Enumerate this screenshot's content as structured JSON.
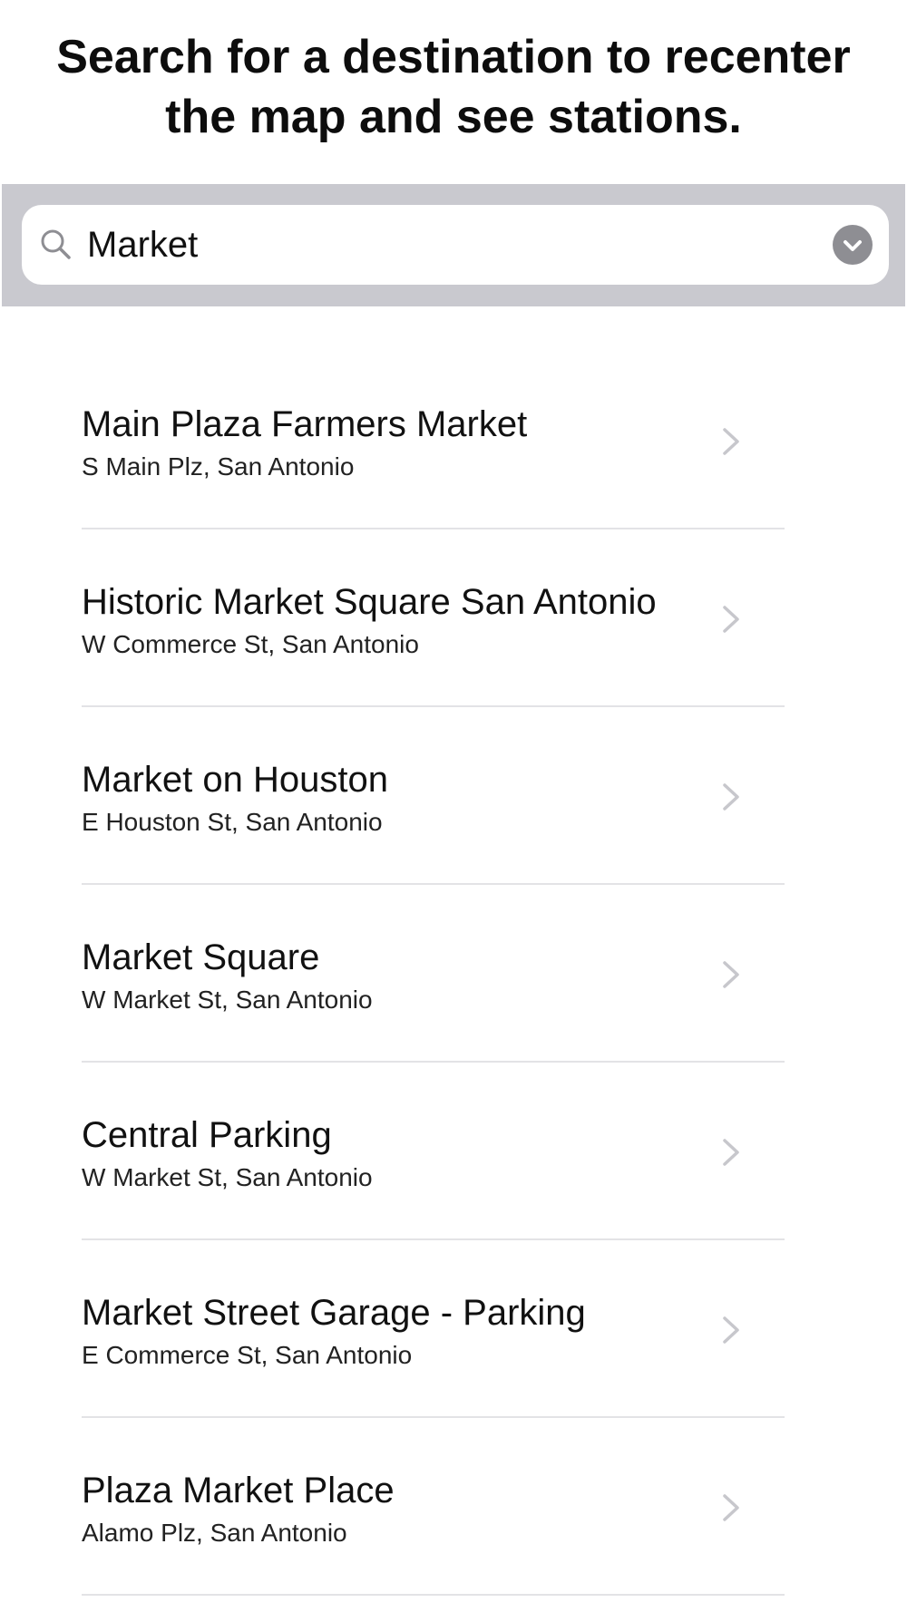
{
  "header": {
    "title_line1": "Search for a destination to recenter",
    "title_line2": "the map and see stations."
  },
  "search": {
    "value": "Market",
    "icon": "search-icon",
    "clear_icon": "clear-circle-icon"
  },
  "colors": {
    "search_bar_bg": "#c9c9cf",
    "clear_button": "#8e8e93",
    "divider": "#e3e3e6",
    "chevron": "#c7c7cc"
  },
  "results": [
    {
      "name": "Main Plaza Farmers Market",
      "address": "S Main Plz, San Antonio"
    },
    {
      "name": "Historic Market Square San Antonio",
      "address": "W Commerce St, San Antonio"
    },
    {
      "name": "Market on Houston",
      "address": "E Houston St, San Antonio"
    },
    {
      "name": "Market Square",
      "address": "W Market St, San Antonio"
    },
    {
      "name": "Central Parking",
      "address": "W Market St, San Antonio"
    },
    {
      "name": "Market Street Garage - Parking",
      "address": "E Commerce St, San Antonio"
    },
    {
      "name": "Plaza Market Place",
      "address": "Alamo Plz, San Antonio"
    }
  ]
}
